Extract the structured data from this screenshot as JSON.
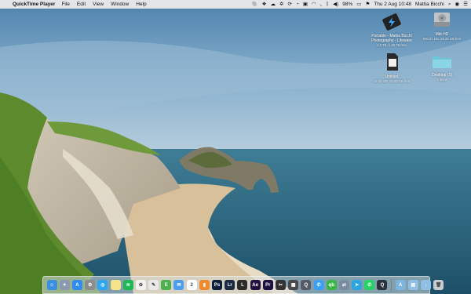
{
  "menubar": {
    "app_name": "QuickTime Player",
    "menus": [
      "File",
      "Edit",
      "View",
      "Window",
      "Help"
    ],
    "battery": "98%",
    "clock": "Thu 2 Aug  10:48",
    "user": "Mattia Bicchi"
  },
  "desktop_icons": [
    {
      "label": "Portable - Mattia Bicchi",
      "label2": "Photography - Lifeware",
      "sub": "2,0 TB, 1,36 TB free",
      "icon": "external-drive-icon"
    },
    {
      "label": "Mitt HD",
      "label2": "",
      "sub": "500,07 GB, 39,33 GB free",
      "icon": "internal-drive-icon"
    },
    {
      "label": "Untitled",
      "label2": "",
      "sub": "15,93 GB, 15,93 GB free",
      "icon": "sd-card-icon"
    },
    {
      "label": "Desktop (1)",
      "label2": "",
      "sub": "3 items",
      "icon": "folder-icon"
    }
  ],
  "dock": {
    "apps": [
      {
        "name": "finder-icon",
        "color": "#3b8fe0",
        "glyph": "☺"
      },
      {
        "name": "launchpad-icon",
        "color": "#8a98b0",
        "glyph": "✦"
      },
      {
        "name": "app-store-icon",
        "color": "#2f8cf0",
        "glyph": "A"
      },
      {
        "name": "system-preferences-icon",
        "color": "#8c8c8c",
        "glyph": "⚙"
      },
      {
        "name": "safari-icon",
        "color": "#2ea7f0",
        "glyph": "◎"
      },
      {
        "name": "notes-icon",
        "color": "#f3e38b",
        "glyph": ""
      },
      {
        "name": "spotify-icon",
        "color": "#1db954",
        "glyph": "≋"
      },
      {
        "name": "photos-icon",
        "color": "#f2f2f2",
        "glyph": "✿"
      },
      {
        "name": "textedit-icon",
        "color": "#e9e9e9",
        "glyph": "✎"
      },
      {
        "name": "evernote-icon",
        "color": "#4fb04f",
        "glyph": "E"
      },
      {
        "name": "mail-icon",
        "color": "#4c9ef0",
        "glyph": "✉"
      },
      {
        "name": "calendar-icon",
        "color": "#ffffff",
        "glyph": "2"
      },
      {
        "name": "books-icon",
        "color": "#f08a2c",
        "glyph": "▮"
      },
      {
        "name": "photoshop-icon",
        "color": "#0b1f3a",
        "glyph": "Ps"
      },
      {
        "name": "lightroom-icon",
        "color": "#1a2a40",
        "glyph": "Lr"
      },
      {
        "name": "lightroom-classic-icon",
        "color": "#2b2b2b",
        "glyph": "L"
      },
      {
        "name": "after-effects-icon",
        "color": "#23123f",
        "glyph": "Ae"
      },
      {
        "name": "premiere-icon",
        "color": "#1c1040",
        "glyph": "Pr"
      },
      {
        "name": "final-cut-icon",
        "color": "#333333",
        "glyph": "✂"
      },
      {
        "name": "compressor-icon",
        "color": "#4a4a4a",
        "glyph": "▦"
      },
      {
        "name": "quicktime-icon",
        "color": "#555a66",
        "glyph": "Q"
      },
      {
        "name": "messages-icon",
        "color": "#3aa0f5",
        "glyph": "✆"
      },
      {
        "name": "qbittorrent-icon",
        "color": "#3ab54a",
        "glyph": "qb"
      },
      {
        "name": "migration-icon",
        "color": "#7a8ca0",
        "glyph": "⇄"
      },
      {
        "name": "telegram-icon",
        "color": "#2ca5e0",
        "glyph": "➤"
      },
      {
        "name": "whatsapp-icon",
        "color": "#25d366",
        "glyph": "✆"
      },
      {
        "name": "quicktime-player-icon",
        "color": "#2a3240",
        "glyph": "Q"
      }
    ],
    "folders": [
      {
        "name": "applications-folder-icon",
        "color": "#7fb4dc",
        "glyph": "A"
      },
      {
        "name": "documents-folder-icon",
        "color": "#8fc0e4",
        "glyph": "▤"
      },
      {
        "name": "downloads-folder-icon",
        "color": "#8fc0e4",
        "glyph": "↓"
      },
      {
        "name": "trash-icon",
        "color": "#c8ccd0",
        "glyph": "🗑"
      }
    ]
  }
}
